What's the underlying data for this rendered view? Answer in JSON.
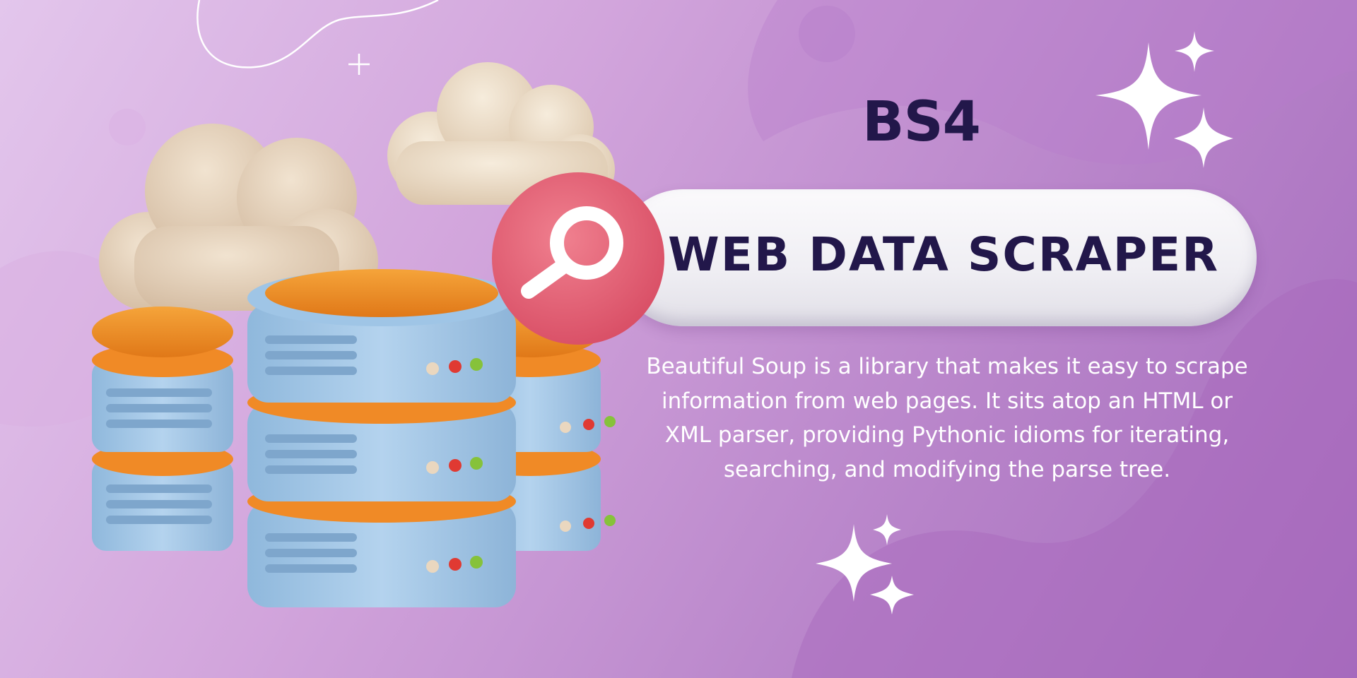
{
  "banner": {
    "title": "BS4",
    "headline": "WEB DATA SCRAPER",
    "description": "Beautiful Soup is a library that makes it easy to scrape information from web pages. It sits atop an HTML or XML parser, providing Pythonic idioms for iterating, searching, and modifying the parse tree."
  },
  "icons": {
    "badge": "magnifying-glass-icon",
    "illustration": "database-servers-icon",
    "clouds": "cloud-icon",
    "decor": "sparkle-icon"
  },
  "colors": {
    "background_light": "#e3c6ec",
    "background_dark": "#a56bbd",
    "title_text": "#22174a",
    "badge_pink": "#e8687f",
    "server_blue": "#a7cbe8",
    "server_orange": "#f08a26",
    "cloud_beige": "#e8d6bf"
  }
}
